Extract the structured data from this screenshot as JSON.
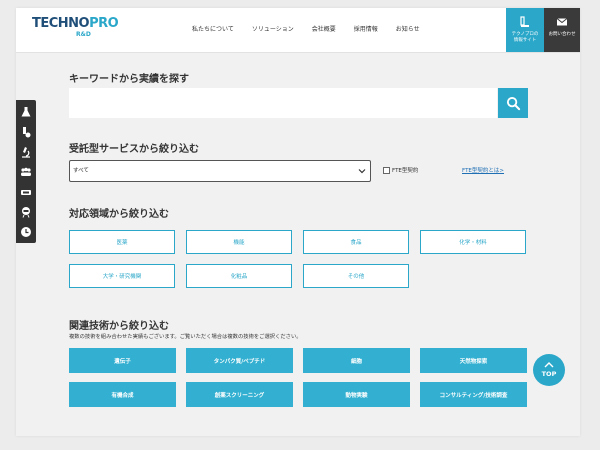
{
  "header": {
    "logo": {
      "main_a": "TECHNO",
      "main_b": "PRO",
      "sub": "R&D"
    },
    "nav": [
      "私たちについて",
      "ソリューション",
      "会社概要",
      "採用情報",
      "お知らせ"
    ],
    "info_button": "テクノプロの\n情報サイト",
    "contact_button": "お問い合わせ"
  },
  "sidebar": {
    "icons": [
      "flask-icon",
      "pipette-icon",
      "microscope-icon",
      "group-icon",
      "device-icon",
      "badge-icon",
      "clock-icon"
    ]
  },
  "keyword": {
    "title": "キーワードから実績を探す",
    "placeholder": "",
    "value": ""
  },
  "service": {
    "title": "受託型サービスから絞り込む",
    "selected": "すべて",
    "fte_label": "FTE型契約",
    "fte_link": "FTE型契約とは>"
  },
  "fields": {
    "title": "対応領域から絞り込む",
    "items": [
      "医薬",
      "機能",
      "食品",
      "化学・材料",
      "大学・研究機関",
      "化粧品",
      "その他"
    ]
  },
  "tech": {
    "title": "関連技術から絞り込む",
    "note": "複数の技術を組み合わせた実績もございます。ご覧いただく場合は複数の技術をご選択ください。",
    "items": [
      "遺伝子",
      "タンパク質/ペプチド",
      "細胞",
      "天然物探索",
      "有機合成",
      "創薬スクリーニング",
      "動物実験",
      "コンサルティング/技術調査"
    ]
  },
  "top_button": "TOP",
  "colors": {
    "accent": "#2ba7c9",
    "dark": "#333333",
    "brand": "#1f4e79"
  }
}
